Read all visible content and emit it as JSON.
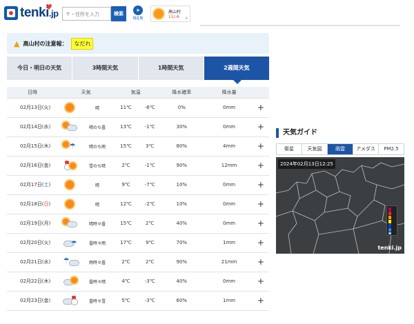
{
  "header": {
    "logo_main": "tenki",
    "logo_suffix": ".jp",
    "search_placeholder": "〒・住所を入力",
    "search_button": "検索",
    "location_label": "現在地",
    "fav_place": "高山村",
    "fav_temp": "11/-6",
    "fav_close": "x"
  },
  "alert": {
    "label": "高山村の注意報：",
    "tag": "なだれ"
  },
  "tabs": [
    {
      "label": "今日・明日の天気"
    },
    {
      "label": "3時間天気"
    },
    {
      "label": "1時間天気"
    },
    {
      "label": "2週間天気",
      "active": true
    }
  ],
  "forecast": {
    "headers": [
      "日時",
      "天気",
      "気温",
      "降水確率",
      "降水量"
    ],
    "rows": [
      {
        "date": "02月13日(火)",
        "icon": "sunny",
        "label": "晴",
        "hi": "11℃",
        "lo": "-6℃",
        "pop": "0%",
        "precip": "0mm"
      },
      {
        "date": "02月14日(水)",
        "icon": "sunny-cloudy",
        "label": "晴のち曇",
        "hi": "13℃",
        "lo": "-1℃",
        "pop": "30%",
        "precip": "0mm"
      },
      {
        "date": "02月15日(木)",
        "icon": "sunny-rain",
        "label": "晴のち雨",
        "hi": "15℃",
        "lo": "3℃",
        "pop": "80%",
        "precip": "4mm"
      },
      {
        "date": "02月16日(金)",
        "icon": "snow-sunny",
        "label": "雪のち晴",
        "hi": "2℃",
        "lo": "-1℃",
        "pop": "90%",
        "precip": "12mm"
      },
      {
        "date": "02月17日(土)",
        "icon": "sunny",
        "label": "晴",
        "hi": "9℃",
        "lo": "-7℃",
        "pop": "10%",
        "precip": "0mm",
        "day": "sat"
      },
      {
        "date": "02月18日(日)",
        "icon": "sunny",
        "label": "晴",
        "hi": "12℃",
        "lo": "-2℃",
        "pop": "10%",
        "precip": "0mm",
        "day": "sun"
      },
      {
        "date": "02月19日(月)",
        "icon": "sunny-cloudy",
        "label": "晴時々曇",
        "hi": "15℃",
        "lo": "2℃",
        "pop": "40%",
        "precip": "0mm"
      },
      {
        "date": "02月20日(火)",
        "icon": "cloudy-rain",
        "label": "曇時々雨",
        "hi": "17℃",
        "lo": "9℃",
        "pop": "70%",
        "precip": "1mm"
      },
      {
        "date": "02月21日(水)",
        "icon": "rain-cloudy",
        "label": "雨時々曇",
        "hi": "2℃",
        "lo": "2℃",
        "pop": "90%",
        "precip": "21mm"
      },
      {
        "date": "02月22日(木)",
        "icon": "cloudy-sunny",
        "label": "曇時々晴",
        "hi": "4℃",
        "lo": "-3℃",
        "pop": "40%",
        "precip": "0mm"
      },
      {
        "date": "02月23日(金)",
        "icon": "cloudy-snow",
        "label": "曇時々雪",
        "hi": "5℃",
        "lo": "-3℃",
        "pop": "60%",
        "precip": "1mm"
      }
    ],
    "expand_symbol": "+"
  },
  "guide": {
    "title": "天気ガイド",
    "tabs": [
      {
        "label": "衛星"
      },
      {
        "label": "天気図"
      },
      {
        "label": "雨雲",
        "active": true
      },
      {
        "label": "アメダス"
      },
      {
        "label": "PM2.5"
      }
    ],
    "timestamp": "2024年02月13日12:25",
    "watermark": "tenki.jp"
  },
  "colors": {
    "accent": "#1c55a5",
    "high_temp": "#e53935",
    "low_temp": "#1a6fd1",
    "alert_bg": "#e8f2fb",
    "alert_tag": "#ffff33"
  }
}
